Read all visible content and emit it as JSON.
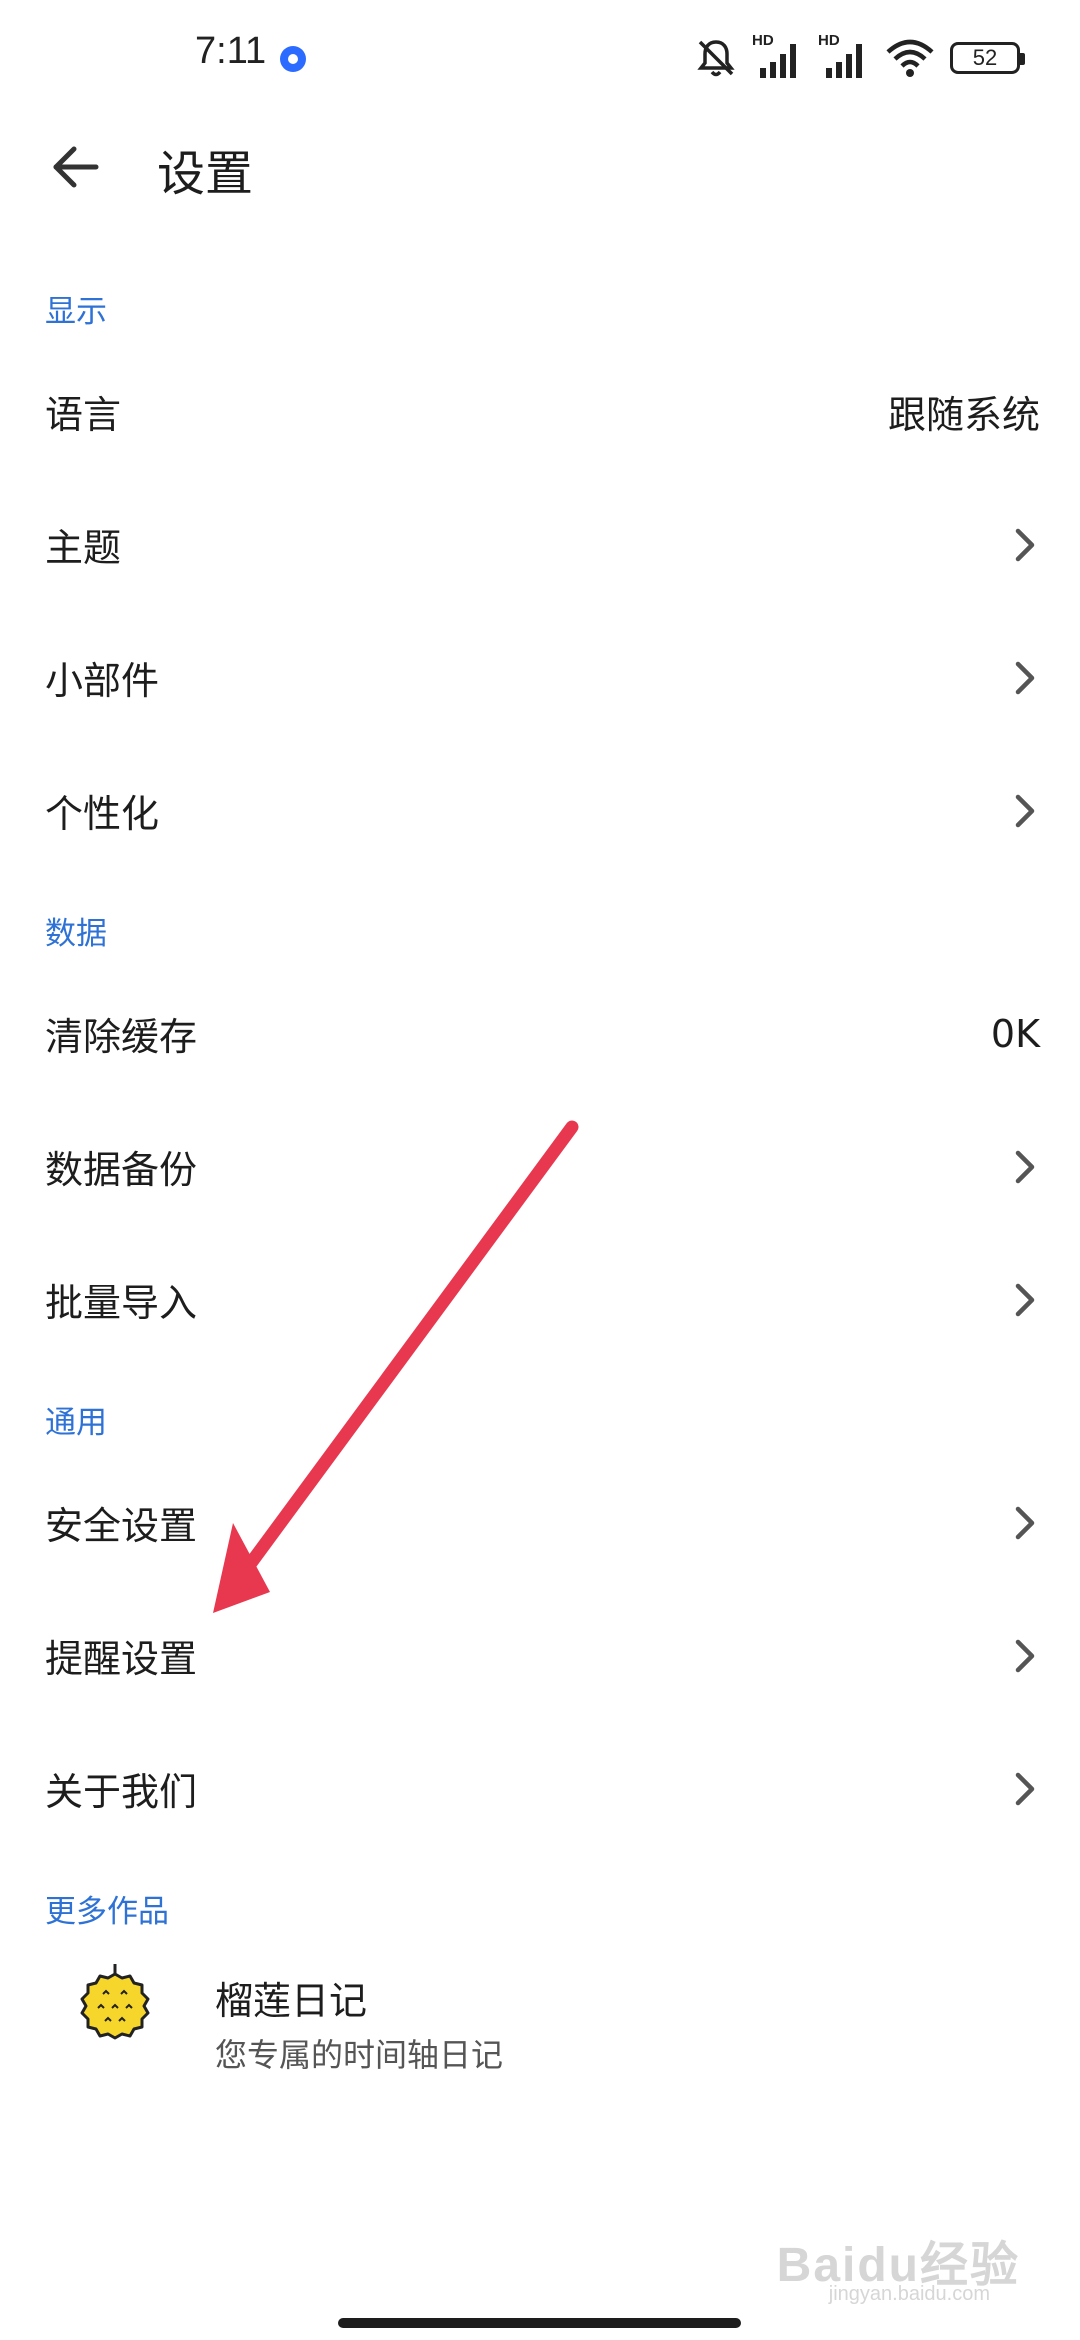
{
  "status_bar": {
    "time": "7:11",
    "battery": "52",
    "network_label_1": "HD",
    "network_label_2": "HD"
  },
  "appbar": {
    "title": "设置"
  },
  "sections": [
    {
      "header": "显示",
      "items": [
        {
          "label": "语言",
          "value": "跟随系统"
        },
        {
          "label": "主题",
          "value": ""
        },
        {
          "label": "小部件",
          "value": ""
        },
        {
          "label": "个性化",
          "value": ""
        }
      ]
    },
    {
      "header": "数据",
      "items": [
        {
          "label": "清除缓存",
          "value": "0K"
        },
        {
          "label": "数据备份",
          "value": ""
        },
        {
          "label": "批量导入",
          "value": ""
        }
      ]
    },
    {
      "header": "通用",
      "items": [
        {
          "label": "安全设置",
          "value": ""
        },
        {
          "label": "提醒设置",
          "value": ""
        },
        {
          "label": "关于我们",
          "value": ""
        }
      ]
    }
  ],
  "more_works": {
    "header": "更多作品",
    "item": {
      "title": "榴莲日记",
      "subtitle": "您专属的时间轴日记",
      "icon": "durian-icon"
    }
  },
  "annotation": {
    "arrow_color": "#e8384f"
  },
  "watermark": {
    "text": "Baidu经验",
    "sub": "jingyan.baidu.com"
  },
  "colors": {
    "accent": "#2f72d6",
    "text": "#1d1d1d"
  }
}
